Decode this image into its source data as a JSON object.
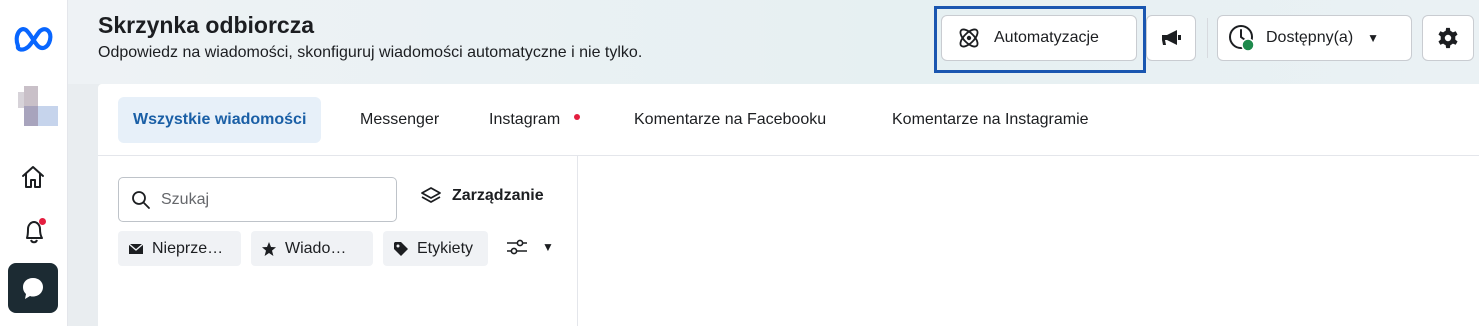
{
  "header": {
    "title": "Skrzynka odbiorcza",
    "subtitle": "Odpowiedz na wiadomości, skonfiguruj wiadomości automatyczne i nie tylko.",
    "automations_label": "Automatyzacje",
    "status_label": "Dostępny(a)"
  },
  "tabs": [
    {
      "label": "Wszystkie wiadomości",
      "active": true
    },
    {
      "label": "Messenger"
    },
    {
      "label": "Instagram",
      "has_notification": true
    },
    {
      "label": "Komentarze na Facebooku"
    },
    {
      "label": "Komentarze na Instagramie"
    }
  ],
  "search": {
    "placeholder": "Szukaj"
  },
  "manage_label": "Zarządzanie",
  "chips": [
    {
      "label": "Nieprze…",
      "icon": "envelope-icon"
    },
    {
      "label": "Wiado…",
      "icon": "star-icon"
    },
    {
      "label": "Etykiety",
      "icon": "tag-icon"
    }
  ],
  "colors": {
    "accent_blue": "#1a5fa6",
    "focus_ring": "#1a56b0",
    "notification_red": "#e41e3f",
    "status_green": "#1e8a4c",
    "rail_active_bg": "#1c2b33"
  }
}
